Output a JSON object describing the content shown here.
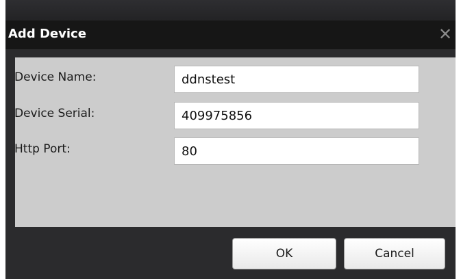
{
  "dialog": {
    "title": "Add Device",
    "close_glyph": "✕",
    "close_icon": "close-icon"
  },
  "form": {
    "device_name": {
      "label": "Device Name:",
      "value": "ddnstest"
    },
    "device_serial": {
      "label": "Device Serial:",
      "value": "409975856"
    },
    "http_port": {
      "label": "Http Port:",
      "value": "80"
    }
  },
  "buttons": {
    "ok_label": "OK",
    "cancel_label": "Cancel"
  },
  "colors": {
    "titlebar": "#161616",
    "dialog_body": "#2b2b2d",
    "content_panel": "#cccccc"
  }
}
